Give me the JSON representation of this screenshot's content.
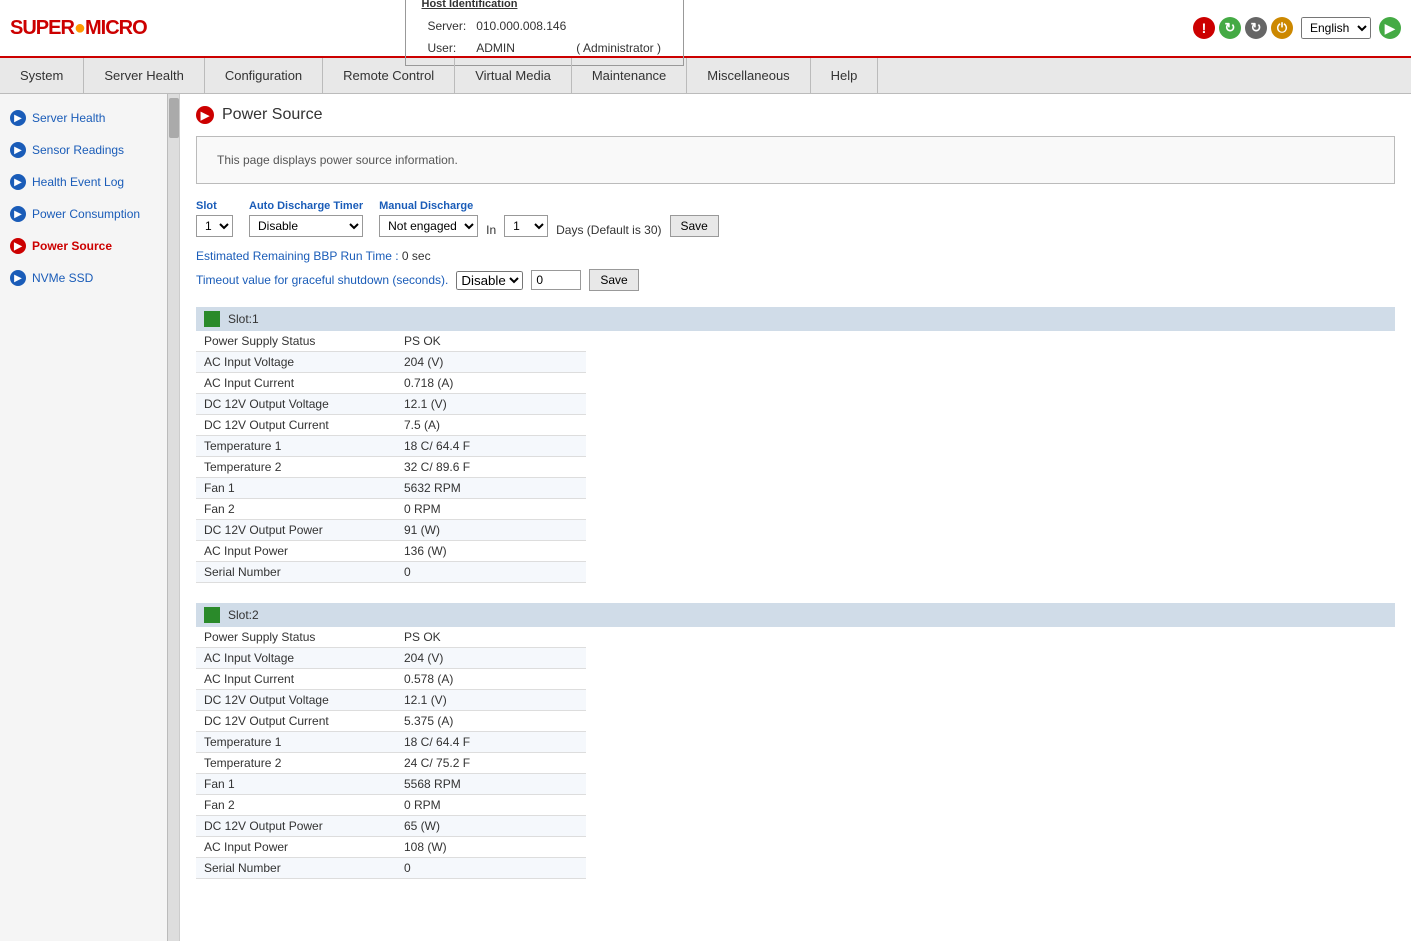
{
  "header": {
    "logo": "Supermicro",
    "host_id_title": "Host Identification",
    "server_label": "Server:",
    "server_value": "010.000.008.146",
    "user_label": "User:",
    "user_value": "ADMIN",
    "user_role": "( Administrator )",
    "language": "English",
    "icons": {
      "alert": "!",
      "refresh1": "↻",
      "refresh2": "↻",
      "power": "⏻",
      "green": "✓"
    }
  },
  "navbar": {
    "items": [
      "System",
      "Server Health",
      "Configuration",
      "Remote Control",
      "Virtual Media",
      "Maintenance",
      "Miscellaneous",
      "Help"
    ]
  },
  "sidebar": {
    "items": [
      {
        "id": "server-health",
        "label": "Server Health",
        "active": false
      },
      {
        "id": "sensor-readings",
        "label": "Sensor Readings",
        "active": false
      },
      {
        "id": "health-event-log",
        "label": "Health Event Log",
        "active": false
      },
      {
        "id": "power-consumption",
        "label": "Power Consumption",
        "active": false
      },
      {
        "id": "power-source",
        "label": "Power Source",
        "active": true
      },
      {
        "id": "nvme-ssd",
        "label": "NVMe SSD",
        "active": false
      }
    ]
  },
  "content": {
    "page_title": "Power Source",
    "info_text": "This page displays power source information.",
    "slot_label": "Slot",
    "slot_value": "1",
    "auto_discharge_label": "Auto Discharge Timer",
    "auto_discharge_value": "Disable",
    "manual_discharge_label": "Manual Discharge",
    "manual_discharge_value": "Not engaged",
    "in_label": "In",
    "days_value": "1",
    "days_label": "Days (Default is 30)",
    "save_label": "Save",
    "estimated_label": "Estimated Remaining BBP Run Time :",
    "estimated_value": "0 sec",
    "timeout_label": "Timeout value for graceful shutdown (seconds).",
    "timeout_select": "Disable",
    "timeout_input": "0",
    "timeout_save": "Save",
    "slot1": {
      "title": "Slot:1",
      "rows": [
        {
          "label": "Power Supply Status",
          "value": "PS OK"
        },
        {
          "label": "AC Input Voltage",
          "value": "204 (V)"
        },
        {
          "label": "AC Input Current",
          "value": "0.718 (A)"
        },
        {
          "label": "DC 12V Output Voltage",
          "value": "12.1 (V)"
        },
        {
          "label": "DC 12V Output Current",
          "value": "7.5 (A)"
        },
        {
          "label": "Temperature 1",
          "value": "18 C/ 64.4 F"
        },
        {
          "label": "Temperature 2",
          "value": "32 C/ 89.6 F"
        },
        {
          "label": "Fan 1",
          "value": "5632 RPM"
        },
        {
          "label": "Fan 2",
          "value": "0 RPM"
        },
        {
          "label": "DC 12V Output Power",
          "value": "91 (W)"
        },
        {
          "label": "AC Input Power",
          "value": "136 (W)"
        },
        {
          "label": "Serial Number",
          "value": "0"
        }
      ]
    },
    "slot2": {
      "title": "Slot:2",
      "rows": [
        {
          "label": "Power Supply Status",
          "value": "PS OK"
        },
        {
          "label": "AC Input Voltage",
          "value": "204 (V)"
        },
        {
          "label": "AC Input Current",
          "value": "0.578 (A)"
        },
        {
          "label": "DC 12V Output Voltage",
          "value": "12.1 (V)"
        },
        {
          "label": "DC 12V Output Current",
          "value": "5.375 (A)"
        },
        {
          "label": "Temperature 1",
          "value": "18 C/ 64.4 F"
        },
        {
          "label": "Temperature 2",
          "value": "24 C/ 75.2 F"
        },
        {
          "label": "Fan 1",
          "value": "5568 RPM"
        },
        {
          "label": "Fan 2",
          "value": "0 RPM"
        },
        {
          "label": "DC 12V Output Power",
          "value": "65 (W)"
        },
        {
          "label": "AC Input Power",
          "value": "108 (W)"
        },
        {
          "label": "Serial Number",
          "value": "0"
        }
      ]
    }
  }
}
